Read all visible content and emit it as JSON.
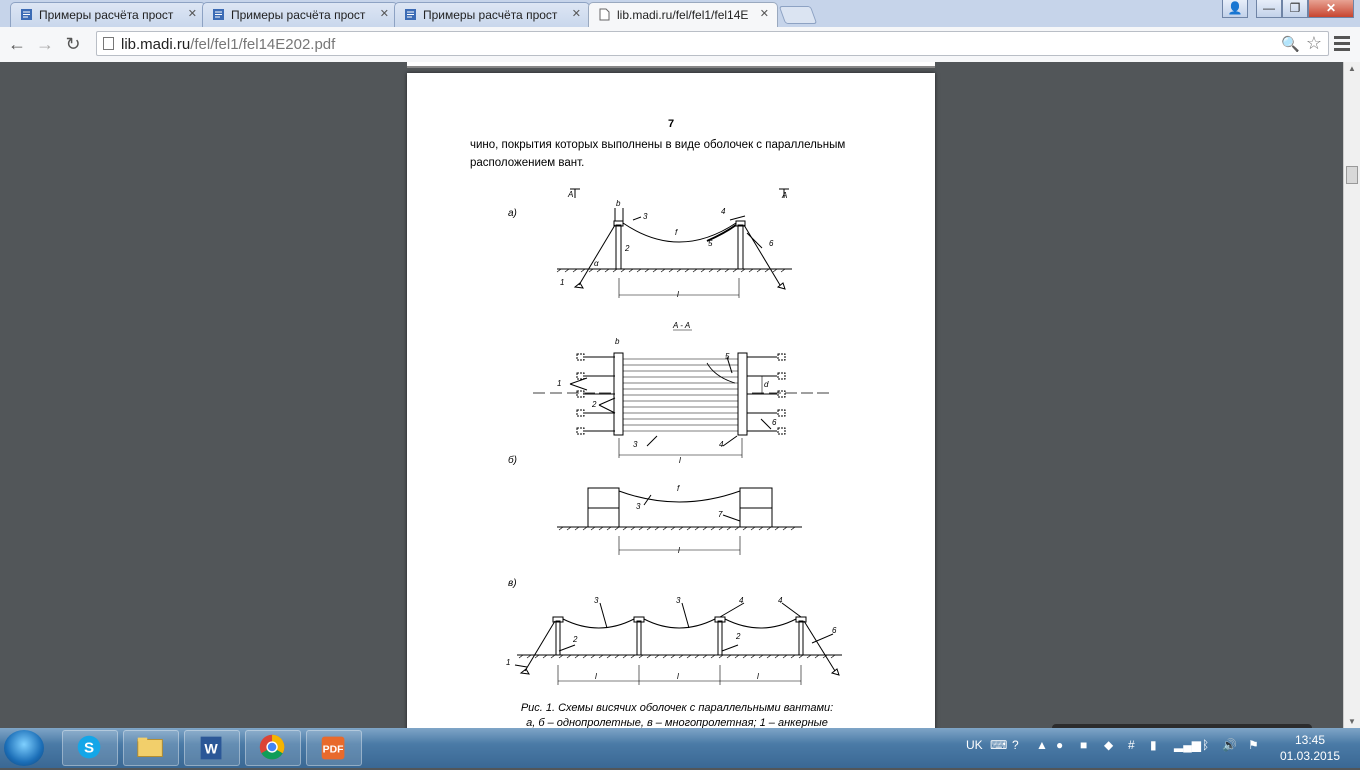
{
  "tabs": [
    {
      "title": "Примеры расчёта прост",
      "active": false
    },
    {
      "title": "Примеры расчёта прост",
      "active": false
    },
    {
      "title": "Примеры расчёта прост",
      "active": false
    },
    {
      "title": "lib.madi.ru/fel/fel1/fel14E",
      "active": true
    }
  ],
  "address": {
    "host": "lib.madi.ru",
    "path": "/fel/fel1/fel14E202.pdf"
  },
  "document": {
    "page_number": "7",
    "text_line1": "чино, покрытия которых выполнены в виде оболочек с параллельным",
    "text_line2": "расположением вант.",
    "caption_line1": "Рис. 1. Схемы висячих оболочек с параллельными вантами:",
    "caption_line2": "а, б – однопролетные, в – многопролетная; 1 – анкерные",
    "fig_labels": {
      "a": "а)",
      "b": "б)",
      "v": "в)",
      "section_A": "A",
      "section_AA": "A - A",
      "span": "l",
      "angle": "α",
      "sag": "f",
      "width_b": "b",
      "depth_d": "d",
      "n1": "1",
      "n2": "2",
      "n3": "3",
      "n4": "4",
      "n5": "5",
      "n6": "6",
      "n7": "7"
    }
  },
  "pdf_toolbar": [
    "fit-page",
    "rotate",
    "zoom-out",
    "zoom-in",
    "save",
    "print"
  ],
  "taskbar": {
    "language": "UK",
    "time": "13:45",
    "date": "01.03.2015",
    "apps": [
      "skype",
      "file-explorer",
      "word",
      "chrome",
      "pdf-reader"
    ]
  }
}
